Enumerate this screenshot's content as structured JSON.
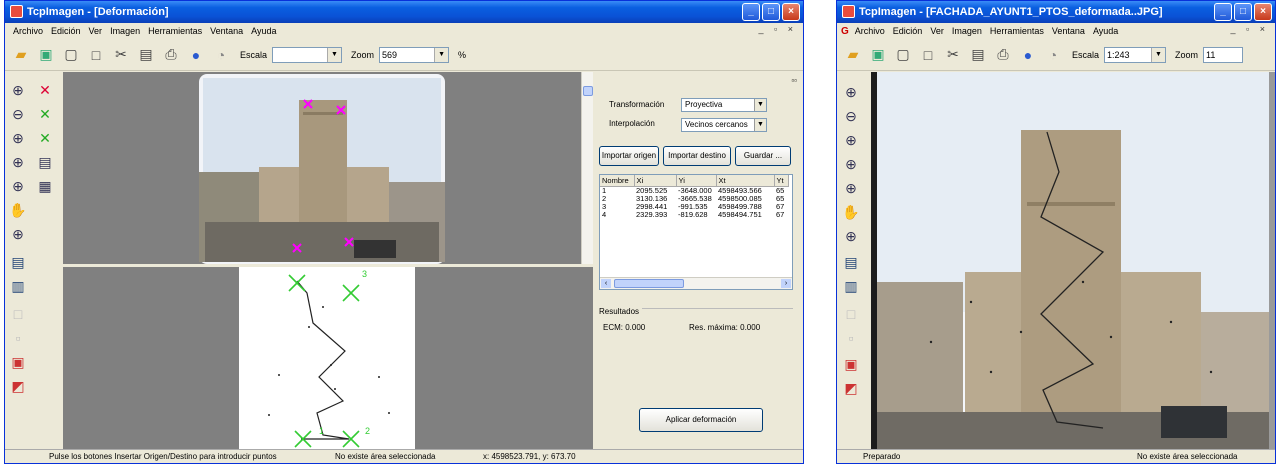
{
  "colors": {
    "titlebar": "#0a52d6",
    "desktop": "#808080",
    "marker": "#ff00ff",
    "control_point": "#33cc33"
  },
  "window1": {
    "title": "TcpImagen - [Deformación]",
    "menu": [
      "Archivo",
      "Edición",
      "Ver",
      "Imagen",
      "Herramientas",
      "Ventana",
      "Ayuda"
    ],
    "mdi_controls": "_ ▫ ×",
    "toolbar": {
      "icons": [
        "open-folder-icon",
        "image-icon",
        "new-doc-icon",
        "blank-icon",
        "cut-icon",
        "save-icon",
        "print-icon",
        "info-icon",
        "help-icon"
      ],
      "escala_label": "Escala",
      "escala_value": "",
      "zoom_label": "Zoom",
      "zoom_value": "569",
      "zoom_unit": "%"
    },
    "panel": {
      "transformacion_label": "Transformación",
      "transformacion_value": "Proyectiva",
      "interpolacion_label": "Interpolación",
      "interpolacion_value": "Vecinos cercanos",
      "btn_importar_origen": "Importar origen",
      "btn_importar_destino": "Importar destino",
      "btn_guardar": "Guardar ...",
      "table": {
        "columns": [
          "Nombre",
          "Xi",
          "Yi",
          "Xt",
          "Yt"
        ],
        "rows": [
          [
            "1",
            "2095.525",
            "-3648.000",
            "4598493.566",
            "65"
          ],
          [
            "2",
            "3130.136",
            "-3665.538",
            "4598500.085",
            "65"
          ],
          [
            "3",
            "2998.441",
            "-991.535",
            "4598499.788",
            "67"
          ],
          [
            "4",
            "2329.393",
            "-819.628",
            "4598494.751",
            "67"
          ]
        ]
      },
      "resultados_label": "Resultados",
      "ecm_text": "ECM: 0.000",
      "res_max_text": "Res. máxima: 0.000",
      "btn_aplicar": "Aplicar deformación"
    },
    "plot_labels": [
      "1",
      "2",
      "3",
      "4"
    ],
    "status": {
      "left": "Pulse los botones Insertar Origen/Destino para introducir puntos",
      "middle": "No existe área seleccionada",
      "right": "x: 4598523.791, y: 673.70"
    }
  },
  "window2": {
    "title": "TcpImagen - [FACHADA_AYUNT1_PTOS_deformada..JPG]",
    "menu": [
      "Archivo",
      "Edición",
      "Ver",
      "Imagen",
      "Herramientas",
      "Ventana",
      "Ayuda"
    ],
    "menu_badge": "G",
    "mdi_controls": "_ ▫ ×",
    "toolbar": {
      "escala_label": "Escala",
      "escala_value": "1:243",
      "zoom_label": "Zoom",
      "zoom_value": "11"
    },
    "status": {
      "left": "Preparado",
      "middle": "No existe área seleccionada"
    }
  }
}
